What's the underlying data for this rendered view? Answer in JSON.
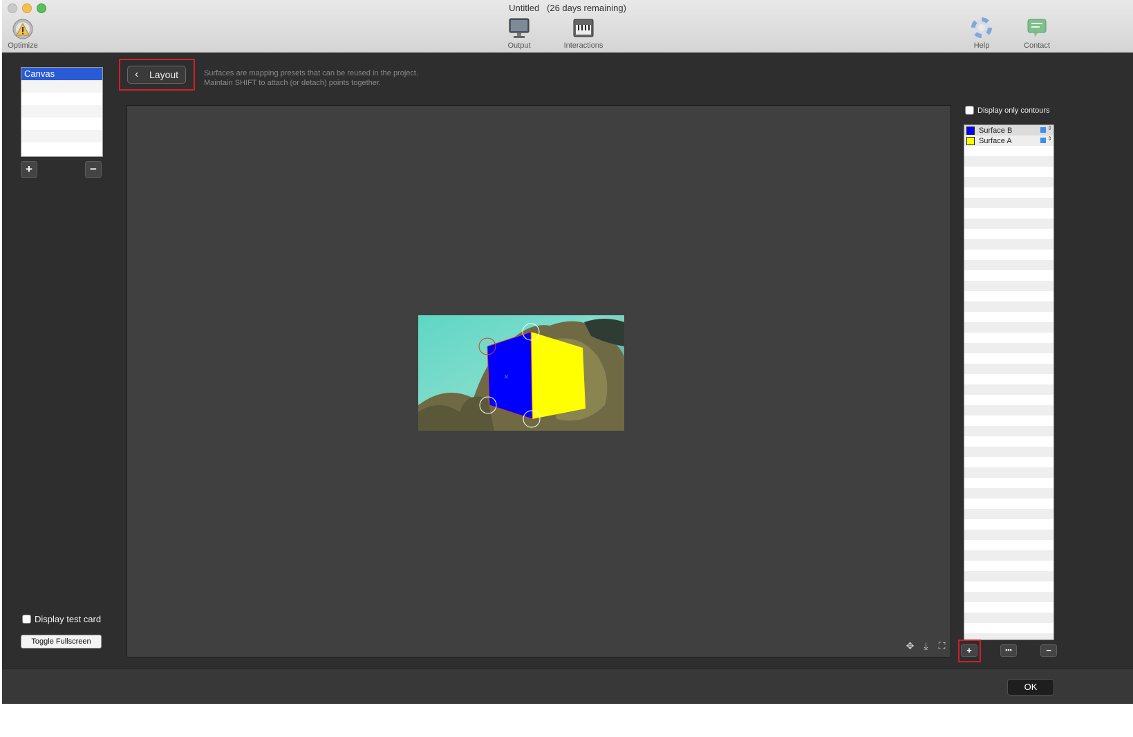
{
  "window": {
    "title": "Untitled",
    "trial_notice": "(26 days remaining)"
  },
  "toolbar": {
    "optimize_label": "Optimize",
    "output_label": "Output",
    "interactions_label": "Interactions",
    "help_label": "Help",
    "contact_label": "Contact"
  },
  "sidebar": {
    "canvas_items": [
      "Canvas"
    ],
    "add_symbol": "+",
    "remove_symbol": "−",
    "display_test_card_label": "Display test card",
    "toggle_fullscreen_label": "Toggle Fullscreen"
  },
  "header": {
    "back_button_label": "Layout",
    "hint_line1": "Surfaces are mapping presets that can be reused in the project.",
    "hint_line2": "Maintain SHIFT to attach (or detach) points together."
  },
  "right_panel": {
    "display_only_contours_label": "Display only contours",
    "surfaces": [
      {
        "name": "Surface B",
        "color": "#0000ff"
      },
      {
        "name": "Surface A",
        "color": "#ffff00"
      }
    ],
    "add_symbol": "+",
    "more_symbol": "•••",
    "remove_symbol": "−"
  },
  "footer": {
    "ok_label": "OK"
  },
  "colors": {
    "selection": "#2a5bd7",
    "highlight_frame": "#d0202a",
    "surface_b": "#0000ff",
    "surface_a": "#ffff00"
  }
}
